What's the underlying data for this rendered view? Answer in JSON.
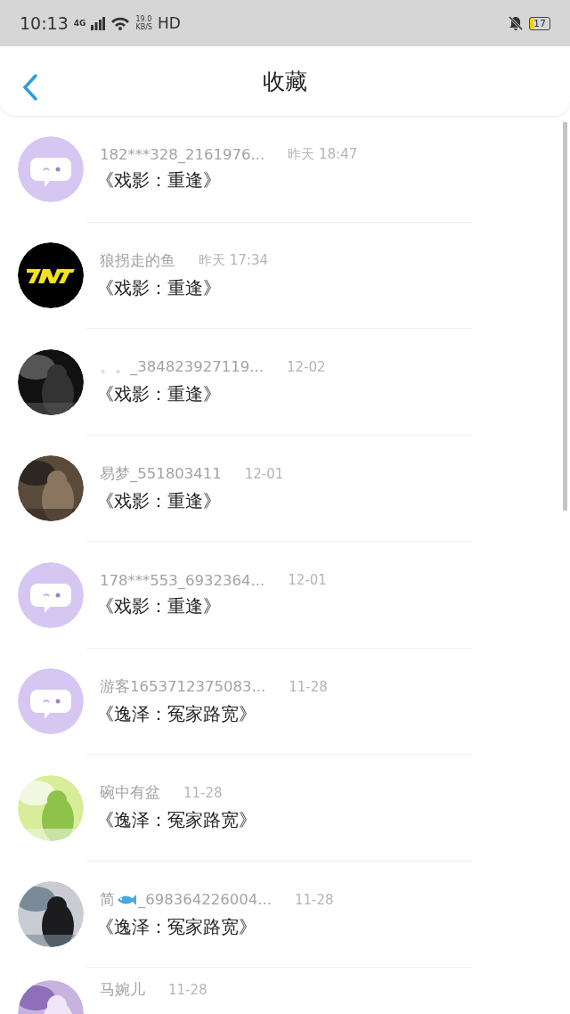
{
  "status_bar": {
    "time": "10:13",
    "network": "4G",
    "speed_value": "19.0",
    "speed_unit": "KB/S",
    "hd": "HD",
    "battery": "17"
  },
  "header": {
    "title": "收藏"
  },
  "items": [
    {
      "avatar": {
        "kind": "default"
      },
      "name": "182***328_2161976...",
      "time": "昨天 18:47",
      "title": "《戏影：重逢》"
    },
    {
      "avatar": {
        "kind": "logo"
      },
      "name": "狼拐走的鱼",
      "time": "昨天 17:34",
      "title": "《戏影：重逢》"
    },
    {
      "name": "。。_384823927119...",
      "time": "12-02",
      "title": "《戏影：重逢》"
    },
    {
      "name": "易梦_551803411",
      "time": "12-01",
      "title": "《戏影：重逢》"
    },
    {
      "avatar": {
        "kind": "default"
      },
      "name": "178***553_6932364...",
      "time": "12-01",
      "title": "《戏影：重逢》"
    },
    {
      "avatar": {
        "kind": "default"
      },
      "name": "游客1653712375083...",
      "time": "11-28",
      "title": "《逸泽：冤家路宽》"
    },
    {
      "name": "碗中有盆",
      "time": "11-28",
      "title": "《逸泽：冤家路宽》"
    },
    {
      "name": "简",
      "name_icon": {
        "kind": "fish"
      },
      "name_rest": "_698364226004...",
      "time": "11-28",
      "title": "《逸泽：冤家路宽》"
    },
    {
      "name": "马婉儿",
      "time": "11-28"
    }
  ]
}
